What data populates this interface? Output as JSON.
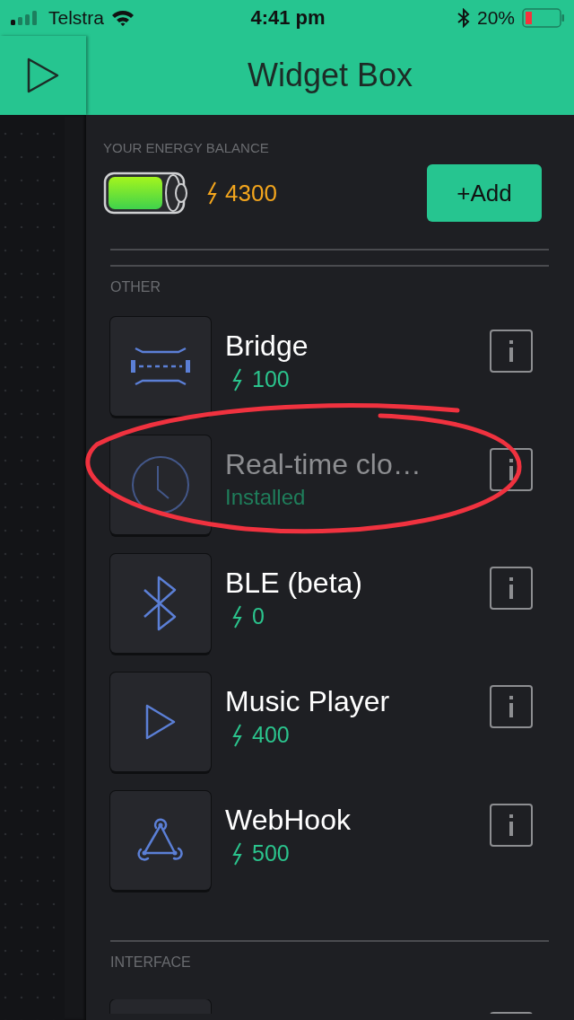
{
  "status_bar": {
    "carrier": "Telstra",
    "time": "4:41 pm",
    "battery_percent": "20%"
  },
  "header": {
    "title": "Widget Box"
  },
  "energy": {
    "label": "YOUR ENERGY BALANCE",
    "amount": "4300",
    "add_button": "+Add"
  },
  "sections": [
    {
      "label": "OTHER",
      "items": [
        {
          "name": "Bridge",
          "kind": "bridge",
          "installed": false,
          "price": "100"
        },
        {
          "name": "Real-time clo…",
          "kind": "clock",
          "installed": true,
          "status": "Installed"
        },
        {
          "name": "BLE (beta)",
          "kind": "bluetooth",
          "installed": false,
          "price": "0"
        },
        {
          "name": "Music Player",
          "kind": "player",
          "installed": false,
          "price": "400"
        },
        {
          "name": "WebHook",
          "kind": "webhook",
          "installed": false,
          "price": "500"
        }
      ]
    },
    {
      "label": "INTERFACE",
      "more_below": true
    }
  ]
}
